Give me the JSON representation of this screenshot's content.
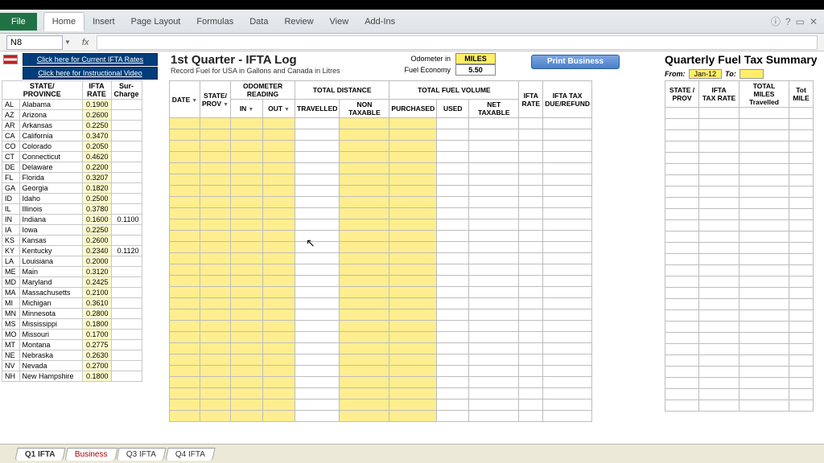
{
  "ribbon": {
    "file": "File",
    "tabs": [
      "Home",
      "Insert",
      "Page Layout",
      "Formulas",
      "Data",
      "Review",
      "View",
      "Add-Ins"
    ]
  },
  "fx": {
    "namebox": "N8",
    "label": "fx"
  },
  "links": {
    "rates": "Click here for Current IFTA Rates",
    "video": "Click here for Instructional Video"
  },
  "state_header": {
    "sp": "STATE/\nPROVINCE",
    "rate": "IFTA\nRATE",
    "sur": "Sur-\nCharge"
  },
  "states": [
    {
      "c": "AL",
      "n": "Alabama",
      "r": "0.1900",
      "s": ""
    },
    {
      "c": "AZ",
      "n": "Arizona",
      "r": "0.2600",
      "s": ""
    },
    {
      "c": "AR",
      "n": "Arkansas",
      "r": "0.2250",
      "s": ""
    },
    {
      "c": "CA",
      "n": "California",
      "r": "0.3470",
      "s": ""
    },
    {
      "c": "CO",
      "n": "Colorado",
      "r": "0.2050",
      "s": ""
    },
    {
      "c": "CT",
      "n": "Connecticut",
      "r": "0.4620",
      "s": ""
    },
    {
      "c": "DE",
      "n": "Delaware",
      "r": "0.2200",
      "s": ""
    },
    {
      "c": "FL",
      "n": "Florida",
      "r": "0.3207",
      "s": ""
    },
    {
      "c": "GA",
      "n": "Georgia",
      "r": "0.1820",
      "s": ""
    },
    {
      "c": "ID",
      "n": "Idaho",
      "r": "0.2500",
      "s": ""
    },
    {
      "c": "IL",
      "n": "Illinois",
      "r": "0.3780",
      "s": ""
    },
    {
      "c": "IN",
      "n": "Indiana",
      "r": "0.1600",
      "s": "0.1100"
    },
    {
      "c": "IA",
      "n": "Iowa",
      "r": "0.2250",
      "s": ""
    },
    {
      "c": "KS",
      "n": "Kansas",
      "r": "0.2600",
      "s": ""
    },
    {
      "c": "KY",
      "n": "Kentucky",
      "r": "0.2340",
      "s": "0.1120"
    },
    {
      "c": "LA",
      "n": "Louisiana",
      "r": "0.2000",
      "s": ""
    },
    {
      "c": "ME",
      "n": "Main",
      "r": "0.3120",
      "s": ""
    },
    {
      "c": "MD",
      "n": "Maryland",
      "r": "0.2425",
      "s": ""
    },
    {
      "c": "MA",
      "n": "Massachusetts",
      "r": "0.2100",
      "s": ""
    },
    {
      "c": "MI",
      "n": "Michigan",
      "r": "0.3610",
      "s": ""
    },
    {
      "c": "MN",
      "n": "Minnesota",
      "r": "0.2800",
      "s": ""
    },
    {
      "c": "MS",
      "n": "Mississippi",
      "r": "0.1800",
      "s": ""
    },
    {
      "c": "MO",
      "n": "Missouri",
      "r": "0.1700",
      "s": ""
    },
    {
      "c": "MT",
      "n": "Montana",
      "r": "0.2775",
      "s": ""
    },
    {
      "c": "NE",
      "n": "Nebraska",
      "r": "0.2630",
      "s": ""
    },
    {
      "c": "NV",
      "n": "Nevada",
      "r": "0.2700",
      "s": ""
    },
    {
      "c": "NH",
      "n": "New Hampshire",
      "r": "0.1800",
      "s": ""
    }
  ],
  "log": {
    "title": "1st Quarter - IFTA Log",
    "sub": "Record Fuel for USA in Gallons and Canada in Litres",
    "odo_lbl": "Odometer in",
    "econ_lbl": "Fuel Economy",
    "miles": "MILES",
    "econ": "5.50",
    "print": "Print Business",
    "group": {
      "odo": "ODOMETER READING",
      "dist": "TOTAL DISTANCE",
      "fuel": "TOTAL FUEL VOLUME"
    },
    "h": {
      "date": "DATE",
      "sp": "STATE/\nPROV",
      "in": "IN",
      "out": "OUT",
      "trav": "TRAVELLED",
      "ntx": "NON TAXABLE",
      "pur": "PURCHASED",
      "used": "USED",
      "net": "NET TAXABLE",
      "rate": "IFTA\nRATE",
      "due": "IFTA TAX\nDUE/REFUND"
    }
  },
  "summary": {
    "title": "Quarterly Fuel Tax Summary",
    "from": "From:",
    "from_v": "Jan-12",
    "to": "To:",
    "h": {
      "sp": "STATE /\nPROV",
      "rate": "IFTA\nTAX RATE",
      "miles": "TOTAL MILES\nTravelled",
      "tot": "Tot\nMILE"
    }
  },
  "tabs": [
    "Q1 IFTA",
    "Business",
    "Q3 IFTA",
    "Q4 IFTA"
  ]
}
